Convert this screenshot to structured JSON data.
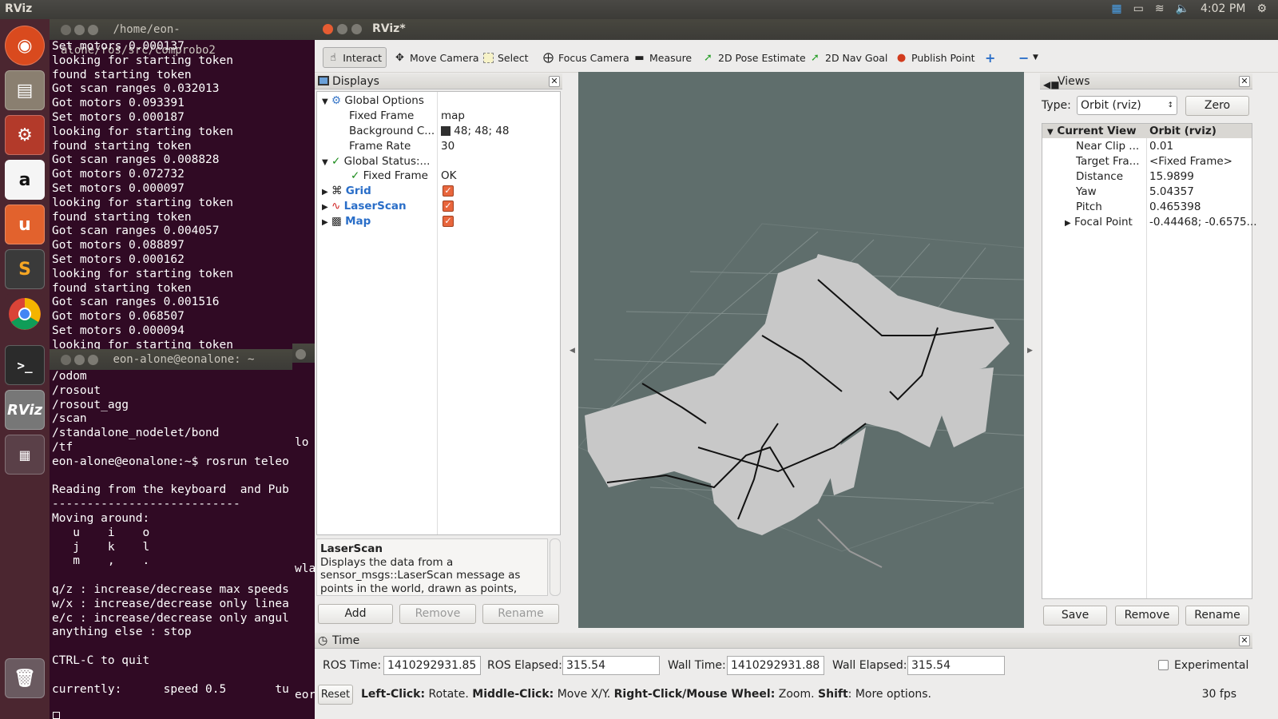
{
  "top_panel": {
    "app_name": "RViz",
    "time": "4:02 PM"
  },
  "launcher": {
    "items": [
      "ubuntu-dash",
      "files",
      "system-settings",
      "amazon",
      "ubuntu-one",
      "sublime-text",
      "chrome",
      "terminal",
      "rviz",
      "workspace-switcher",
      "trash"
    ],
    "amazon_label": "a",
    "ubuntu_one_label": "u",
    "sublime_label": "S",
    "terminal_label": ">_",
    "rviz_label": "RViz"
  },
  "terminal1": {
    "title": "/home/eon-alone/ros/src/comprobo2",
    "lines": [
      "Set motors 0.000137",
      "looking for starting token",
      "found starting token",
      "Got scan ranges 0.032013",
      "Got motors 0.093391",
      "Set motors 0.000187",
      "looking for starting token",
      "found starting token",
      "Got scan ranges 0.008828",
      "Got motors 0.072732",
      "Set motors 0.000097",
      "looking for starting token",
      "found starting token",
      "Got scan ranges 0.004057",
      "Got motors 0.088897",
      "Set motors 0.000162",
      "looking for starting token",
      "found starting token",
      "Got scan ranges 0.001516",
      "Got motors 0.068507",
      "Set motors 0.000094",
      "looking for starting token"
    ]
  },
  "terminal2": {
    "title": "eon-alone@eonalone: ~",
    "lines": [
      "/odom",
      "/rosout",
      "/rosout_agg",
      "/scan",
      "/standalone_nodelet/bond",
      "/tf",
      "eon-alone@eonalone:~$ rosrun teleo",
      "",
      "Reading from the keyboard  and Pub",
      "---------------------------",
      "Moving around:",
      "   u    i    o",
      "   j    k    l",
      "   m    ,    .",
      "",
      "q/z : increase/decrease max speeds",
      "w/x : increase/decrease only linea",
      "e/c : increase/decrease only angul",
      "anything else : stop",
      "",
      "CTRL-C to quit",
      "",
      "currently:      speed 0.5       tu"
    ]
  },
  "terminal3_fragments": [
    "lo",
    "wla",
    "eor"
  ],
  "rviz": {
    "title": "RViz*",
    "toolbar": {
      "interact": "Interact",
      "move_camera": "Move Camera",
      "select": "Select",
      "focus_camera": "Focus Camera",
      "measure": "Measure",
      "pose_estimate": "2D Pose Estimate",
      "nav_goal": "2D Nav Goal",
      "publish_point": "Publish Point",
      "add": "+",
      "remove": "−"
    },
    "displays": {
      "title": "Displays",
      "global_options": "Global Options",
      "fixed_frame_label": "Fixed Frame",
      "fixed_frame_value": "map",
      "background_label": "Background C...",
      "background_value": "48; 48; 48",
      "frame_rate_label": "Frame Rate",
      "frame_rate_value": "30",
      "global_status": "Global Status:...",
      "status_fixed_frame": "Fixed Frame",
      "status_fixed_frame_value": "OK",
      "grid": "Grid",
      "laserscan": "LaserScan",
      "map": "Map",
      "desc_title": "LaserScan",
      "desc_text": "Displays the data from a sensor_msgs::LaserScan message as points in the world, drawn as points, billboards, or",
      "add_btn": "Add",
      "remove_btn": "Remove",
      "rename_btn": "Rename"
    },
    "views": {
      "title": "Views",
      "type_label": "Type:",
      "type_value": "Orbit (rviz)",
      "zero_btn": "Zero",
      "current_view": "Current View",
      "current_view_value": "Orbit (rviz)",
      "near_clip": "Near Clip ...",
      "near_clip_value": "0.01",
      "target_frame": "Target Fra...",
      "target_frame_value": "<Fixed Frame>",
      "distance": "Distance",
      "distance_value": "15.9899",
      "yaw": "Yaw",
      "yaw_value": "5.04357",
      "pitch": "Pitch",
      "pitch_value": "0.465398",
      "focal_point": "Focal Point",
      "focal_point_value": "-0.44468; -0.6575...",
      "save_btn": "Save",
      "remove_btn": "Remove",
      "rename_btn": "Rename"
    },
    "time": {
      "title": "Time",
      "ros_time_label": "ROS Time:",
      "ros_time": "1410292931.85",
      "ros_elapsed_label": "ROS Elapsed:",
      "ros_elapsed": "315.54",
      "wall_time_label": "Wall Time:",
      "wall_time": "1410292931.88",
      "wall_elapsed_label": "Wall Elapsed:",
      "wall_elapsed": "315.54",
      "experimental": "Experimental"
    },
    "status": {
      "reset": "Reset",
      "left_click": "Left-Click:",
      "rotate": " Rotate. ",
      "middle_click": "Middle-Click:",
      "move": " Move X/Y. ",
      "right_click": "Right-Click/Mouse Wheel:",
      "zoom": " Zoom. ",
      "shift": "Shift",
      "more": ": More options.",
      "fps": "30 fps"
    },
    "colors": {
      "viewport_bg": "#5f6e6c",
      "map_free": "#c8c8c8",
      "map_occupied": "#111111",
      "link": "#2a6ec8"
    }
  }
}
